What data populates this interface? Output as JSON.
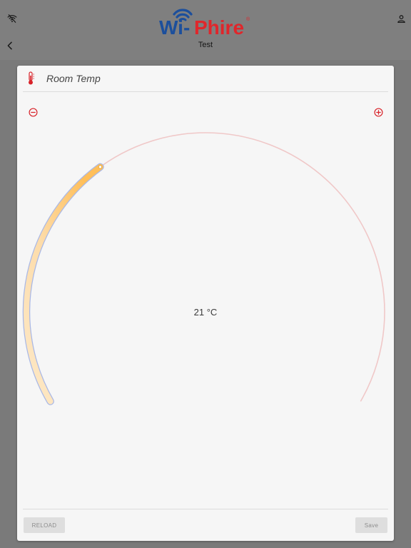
{
  "header": {
    "logo_text_left": "Wi-",
    "logo_text_right": "Phire",
    "logo_mark": "®",
    "subtitle": "Test",
    "wifi_icon": "wifi-off-icon",
    "account_icon": "account-icon",
    "back_icon": "chevron-left-icon"
  },
  "widget": {
    "title": "Room Temp",
    "title_icon": "thermometer-icon",
    "decrement_icon": "minus-circle-icon",
    "increment_icon": "plus-circle-icon",
    "value_display": "21 °C",
    "dial_fill_fraction": 0.35
  },
  "footer": {
    "reload_label": "RELOAD",
    "save_label": "Save"
  },
  "colors": {
    "accent_red": "#d8232a",
    "logo_blue": "#1c4f9c",
    "logo_red": "#e0262b",
    "dial_track": "#f0c8c8",
    "dial_fill_start": "#fde9c8",
    "dial_fill_end": "#ffbf5a",
    "dial_outline": "#a9b8e6"
  }
}
